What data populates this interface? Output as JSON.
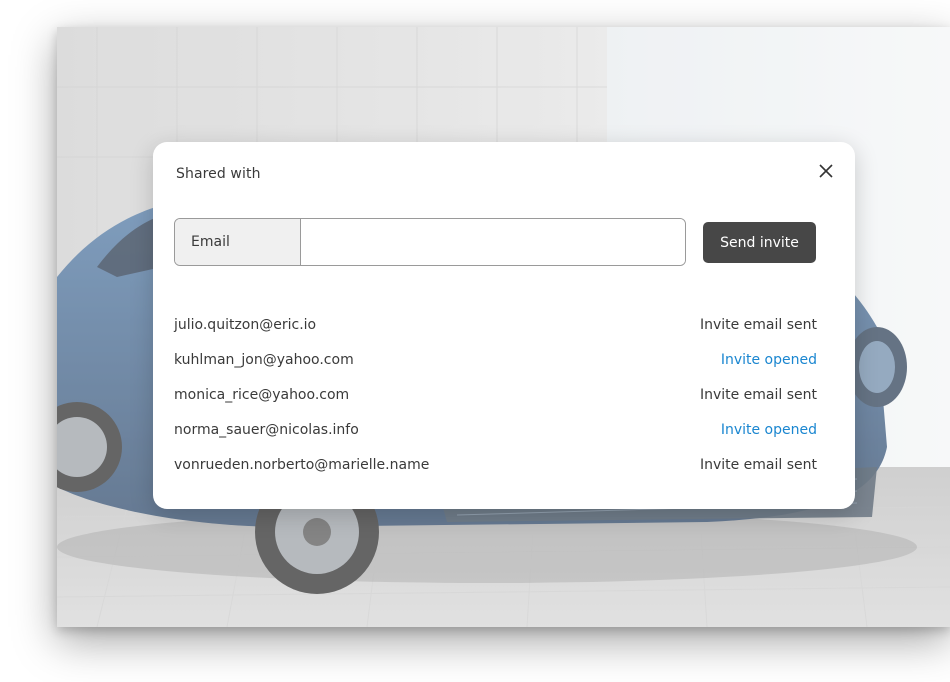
{
  "modal": {
    "title": "Shared with",
    "email_label": "Email",
    "email_value": "",
    "send_label": "Send invite"
  },
  "shares": [
    {
      "email": "julio.quitzon@eric.io",
      "status": "Invite email sent",
      "state": "sent"
    },
    {
      "email": "kuhlman_jon@yahoo.com",
      "status": "Invite opened",
      "state": "opened"
    },
    {
      "email": "monica_rice@yahoo.com",
      "status": "Invite email sent",
      "state": "sent"
    },
    {
      "email": "norma_sauer@nicolas.info",
      "status": "Invite opened",
      "state": "opened"
    },
    {
      "email": "vonrueden.norberto@marielle.name",
      "status": "Invite email sent",
      "state": "sent"
    }
  ],
  "colors": {
    "opened_status": "#1a86d0",
    "button_bg": "#474747"
  },
  "icons": {
    "close": "close-icon"
  }
}
